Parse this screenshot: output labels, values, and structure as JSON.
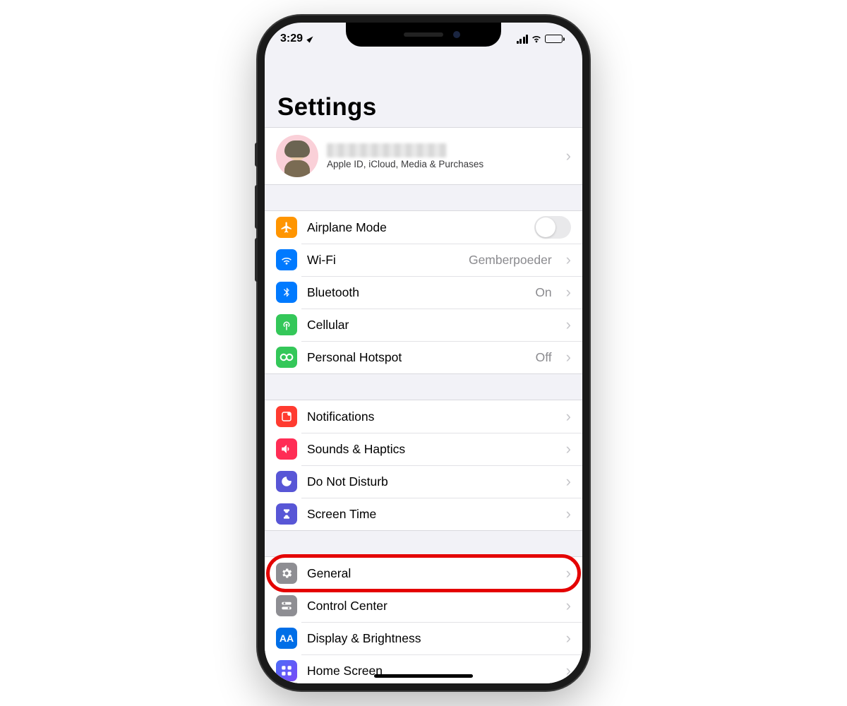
{
  "status_bar": {
    "time": "3:29"
  },
  "title": "Settings",
  "apple_id": {
    "subtitle": "Apple ID, iCloud, Media & Purchases"
  },
  "rows": {
    "airplane": "Airplane Mode",
    "wifi": "Wi-Fi",
    "wifi_value": "Gemberpoeder",
    "bluetooth": "Bluetooth",
    "bluetooth_value": "On",
    "cellular": "Cellular",
    "hotspot": "Personal Hotspot",
    "hotspot_value": "Off",
    "notifications": "Notifications",
    "sounds": "Sounds & Haptics",
    "dnd": "Do Not Disturb",
    "screentime": "Screen Time",
    "general": "General",
    "control": "Control Center",
    "display": "Display & Brightness",
    "home": "Home Screen"
  },
  "highlighted_row": "general"
}
